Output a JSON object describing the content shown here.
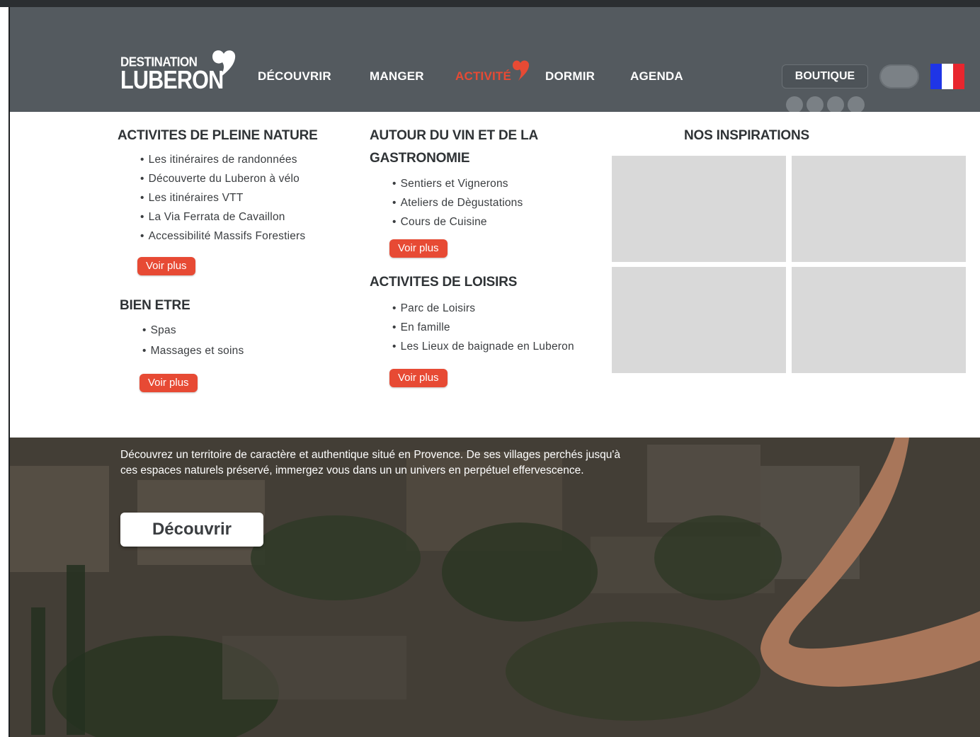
{
  "header": {
    "logo": {
      "top": "DESTINATION",
      "main": "LUBERON"
    },
    "nav": [
      {
        "label": "DÉCOUVRIR",
        "active": false
      },
      {
        "label": "MANGER",
        "active": false
      },
      {
        "label": "ACTIVITÉ",
        "active": true
      },
      {
        "label": "DORMIR",
        "active": false
      },
      {
        "label": "AGENDA",
        "active": false
      }
    ],
    "boutique_label": "BOUTIQUE",
    "language_flag": "france-flag-icon",
    "accent_color": "#e74a34",
    "header_color": "#545a5f"
  },
  "menu": {
    "pleine_nature": {
      "title": "ACTIVITES DE PLEINE NATURE",
      "items": [
        "Les itinéraires  de randonnées",
        "Découverte  du Luberon à vélo",
        "Les itinéraires VTT",
        "La Via Ferrata de Cavaillon",
        "Accessibilité Massifs Forestiers"
      ],
      "more": "Voir plus"
    },
    "bien_etre": {
      "title": "BIEN ETRE",
      "items": [
        "Spas",
        "Massages et soins"
      ],
      "more": "Voir plus"
    },
    "vin": {
      "title_line1": "AUTOUR DU VIN ET DE LA",
      "title_line2": "GASTRONOMIE",
      "items": [
        "Sentiers et Vignerons",
        "Ateliers de Dègustations",
        "Cours de Cuisine"
      ],
      "more": "Voir plus"
    },
    "loisirs": {
      "title": "ACTIVITES DE LOISIRS",
      "items": [
        "Parc de Loisirs",
        "En famille",
        "Les Lieux de baignade en Luberon"
      ],
      "more": "Voir plus"
    },
    "inspirations": {
      "title": "NOS INSPIRATIONS"
    }
  },
  "hero": {
    "text": "Découvrez un territoire de caractère et authentique situé en Provence. De ses villages perchés jusqu'à ces espaces naturels préservé, immergez vous dans un un univers en perpétuel effervescence.",
    "button_label": "Découvrir"
  }
}
